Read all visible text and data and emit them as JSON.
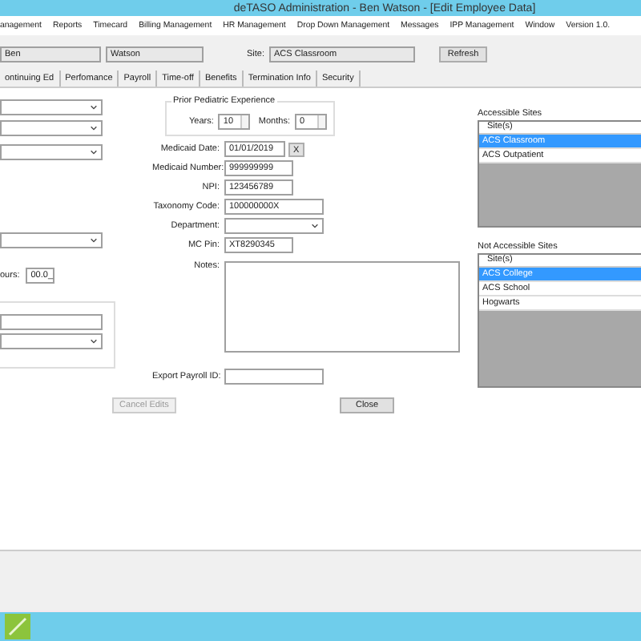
{
  "window": {
    "title": "deTASO Administration - Ben Watson - [Edit Employee Data]"
  },
  "menu": [
    "anagement",
    "Reports",
    "Timecard",
    "Billing Management",
    "HR Management",
    "Drop Down Management",
    "Messages",
    "IPP Management",
    "Window",
    "Version 1.0."
  ],
  "header": {
    "first_name": "Ben",
    "last_name": "Watson",
    "site_label": "Site:",
    "site": "ACS Classroom",
    "refresh": "Refresh"
  },
  "tabs": [
    {
      "label": "ontinuing Ed",
      "selected": false
    },
    {
      "label": "Perfomance",
      "selected": false
    },
    {
      "label": "Payroll",
      "selected": false
    },
    {
      "label": "Time-off",
      "selected": false
    },
    {
      "label": "Benefits",
      "selected": false
    },
    {
      "label": "Termination Info",
      "selected": false
    },
    {
      "label": "Security",
      "selected": false
    }
  ],
  "left": {
    "hours_label": "ours:",
    "hours_value": "00.0_"
  },
  "prior_experience": {
    "title": "Prior Pediatric Experience",
    "years_label": "Years:",
    "years": "10",
    "months_label": "Months:",
    "months": "0"
  },
  "fields": [
    {
      "kind": "date",
      "label": "Medicaid Date:",
      "value": "01/01/2019",
      "clear": "X"
    },
    {
      "kind": "text",
      "label": "Medicaid Number:",
      "value": "999999999"
    },
    {
      "kind": "text",
      "label": "NPI:",
      "value": "123456789"
    },
    {
      "kind": "wide",
      "label": "Taxonomy Code:",
      "value": "100000000X"
    },
    {
      "kind": "select",
      "label": "Department:"
    },
    {
      "kind": "text",
      "label": "MC Pin:",
      "value": "XT8290345"
    },
    {
      "kind": "textarea",
      "label": "Notes:"
    },
    {
      "kind": "wide",
      "label": "Export Payroll ID:"
    }
  ],
  "site_lists": [
    {
      "label": "Accessible Sites",
      "header": "Site(s)",
      "items": [
        {
          "name": "ACS Classroom",
          "selected": true
        },
        {
          "name": "ACS Outpatient",
          "selected": false
        }
      ]
    },
    {
      "label": "Not Accessible Sites",
      "header": "Site(s)",
      "items": [
        {
          "name": "ACS College",
          "selected": true
        },
        {
          "name": "ACS School",
          "selected": false
        },
        {
          "name": "Hogwarts",
          "selected": false
        }
      ]
    }
  ],
  "buttons": [
    {
      "label": "Cancel Edits",
      "disabled": true
    },
    {
      "label": "Close",
      "disabled": false
    }
  ]
}
